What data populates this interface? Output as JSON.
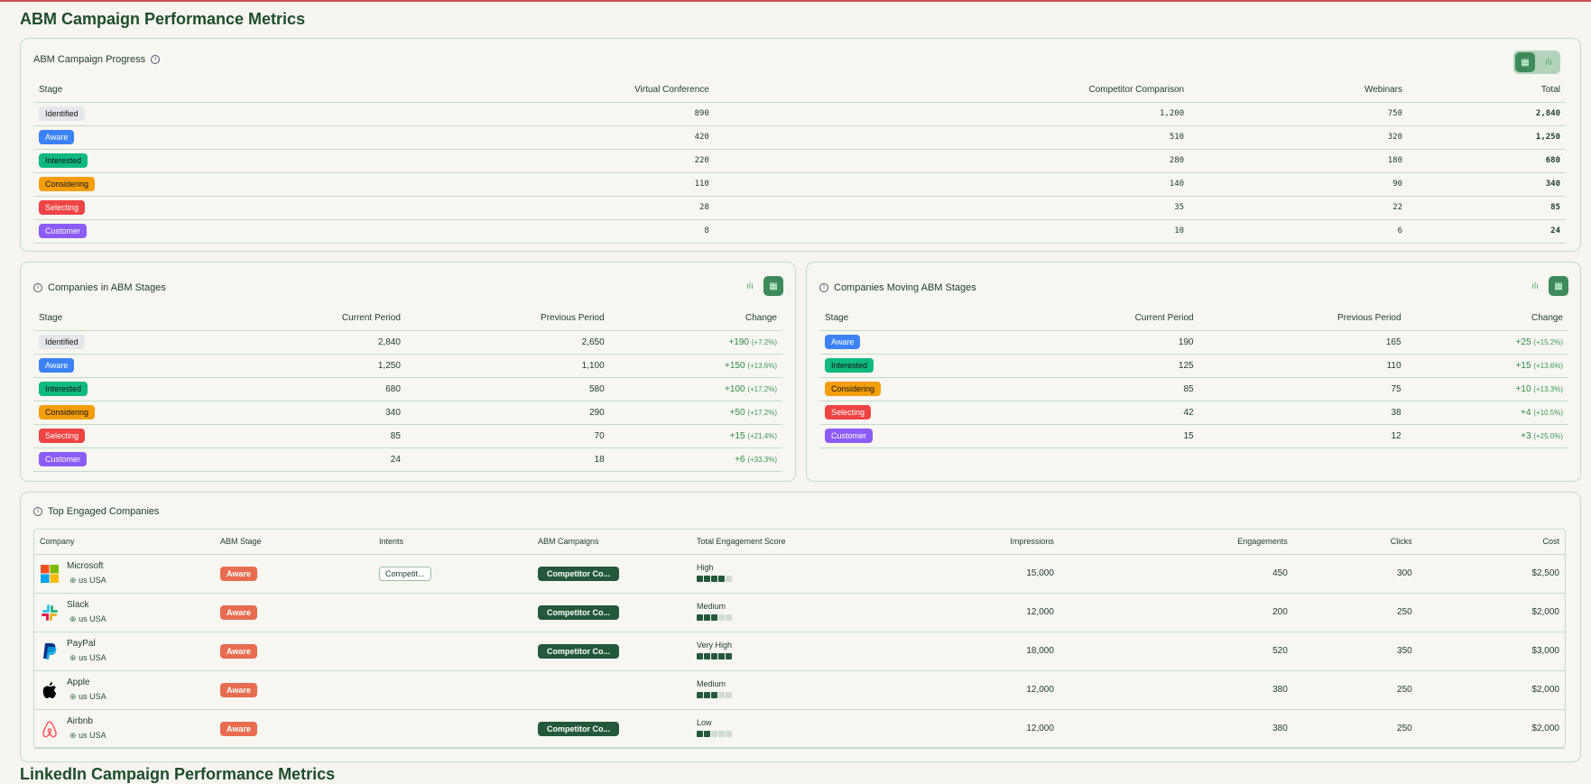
{
  "page_title": "ABM Campaign Performance Metrics",
  "next_section_title": "LinkedIn Campaign Performance Metrics",
  "stage_colors": {
    "Identified": "#e5e7eb",
    "Aware": "#3b82f6",
    "Interested": "#10b981",
    "Considering": "#f59e0b",
    "Selecting": "#ef4444",
    "Customer": "#8b5cf6"
  },
  "progress": {
    "title": "ABM Campaign Progress",
    "headers": [
      "Stage",
      "Virtual Conference",
      "Competitor Comparison",
      "Webinars",
      "Total"
    ],
    "rows": [
      [
        "Identified",
        "890",
        "1,200",
        "750",
        "2,840"
      ],
      [
        "Aware",
        "420",
        "510",
        "320",
        "1,250"
      ],
      [
        "Interested",
        "220",
        "280",
        "180",
        "680"
      ],
      [
        "Considering",
        "110",
        "140",
        "90",
        "340"
      ],
      [
        "Selecting",
        "28",
        "35",
        "22",
        "85"
      ],
      [
        "Customer",
        "8",
        "10",
        "6",
        "24"
      ]
    ]
  },
  "in_stages": {
    "title": "Companies in ABM Stages",
    "headers": [
      "Stage",
      "Current Period",
      "Previous Period",
      "Change"
    ],
    "rows": [
      [
        "Identified",
        "2,840",
        "2,650",
        "+190",
        "(+7.2%)"
      ],
      [
        "Aware",
        "1,250",
        "1,100",
        "+150",
        "(+13.6%)"
      ],
      [
        "Interested",
        "680",
        "580",
        "+100",
        "(+17.2%)"
      ],
      [
        "Considering",
        "340",
        "290",
        "+50",
        "(+17.2%)"
      ],
      [
        "Selecting",
        "85",
        "70",
        "+15",
        "(+21.4%)"
      ],
      [
        "Customer",
        "24",
        "18",
        "+6",
        "(+33.3%)"
      ]
    ]
  },
  "moving": {
    "title": "Companies Moving ABM Stages",
    "headers": [
      "Stage",
      "Current Period",
      "Previous Period",
      "Change"
    ],
    "rows": [
      [
        "Aware",
        "190",
        "165",
        "+25",
        "(+15.2%)"
      ],
      [
        "Interested",
        "125",
        "110",
        "+15",
        "(+13.6%)"
      ],
      [
        "Considering",
        "85",
        "75",
        "+10",
        "(+13.3%)"
      ],
      [
        "Selecting",
        "42",
        "38",
        "+4",
        "(+10.5%)"
      ],
      [
        "Customer",
        "15",
        "12",
        "+3",
        "(+25.0%)"
      ]
    ]
  },
  "top": {
    "title": "Top Engaged Companies",
    "headers": [
      "Company",
      "ABM Stage",
      "Intents",
      "ABM Campaigns",
      "Total Engagement Score",
      "Impressions",
      "Engagements",
      "Clicks",
      "Cost"
    ],
    "rows": [
      {
        "name": "Microsoft",
        "logo": "microsoft-logo",
        "loc": "us USA",
        "stage": "Aware",
        "intent": "Competit...",
        "campaign": "Competitor Co...",
        "score": "High",
        "level": 4,
        "impr": "15,000",
        "eng": "450",
        "clicks": "300",
        "cost": "$2,500"
      },
      {
        "name": "Slack",
        "logo": "slack-logo",
        "loc": "us USA",
        "stage": "Aware",
        "intent": "",
        "campaign": "Competitor Co...",
        "score": "Medium",
        "level": 3,
        "impr": "12,000",
        "eng": "200",
        "clicks": "250",
        "cost": "$2,000"
      },
      {
        "name": "PayPal",
        "logo": "paypal-logo",
        "loc": "us USA",
        "stage": "Aware",
        "intent": "",
        "campaign": "Competitor Co...",
        "score": "Very High",
        "level": 5,
        "impr": "18,000",
        "eng": "520",
        "clicks": "350",
        "cost": "$3,000"
      },
      {
        "name": "Apple",
        "logo": "apple-logo",
        "loc": "us USA",
        "stage": "Aware",
        "intent": "",
        "campaign": "",
        "score": "Medium",
        "level": 3,
        "impr": "12,000",
        "eng": "380",
        "clicks": "250",
        "cost": "$2,000"
      },
      {
        "name": "Airbnb",
        "logo": "airbnb-logo",
        "loc": "us USA",
        "stage": "Aware",
        "intent": "",
        "campaign": "Competitor Co...",
        "score": "Low",
        "level": 2,
        "impr": "12,000",
        "eng": "380",
        "clicks": "250",
        "cost": "$2,000"
      }
    ]
  }
}
